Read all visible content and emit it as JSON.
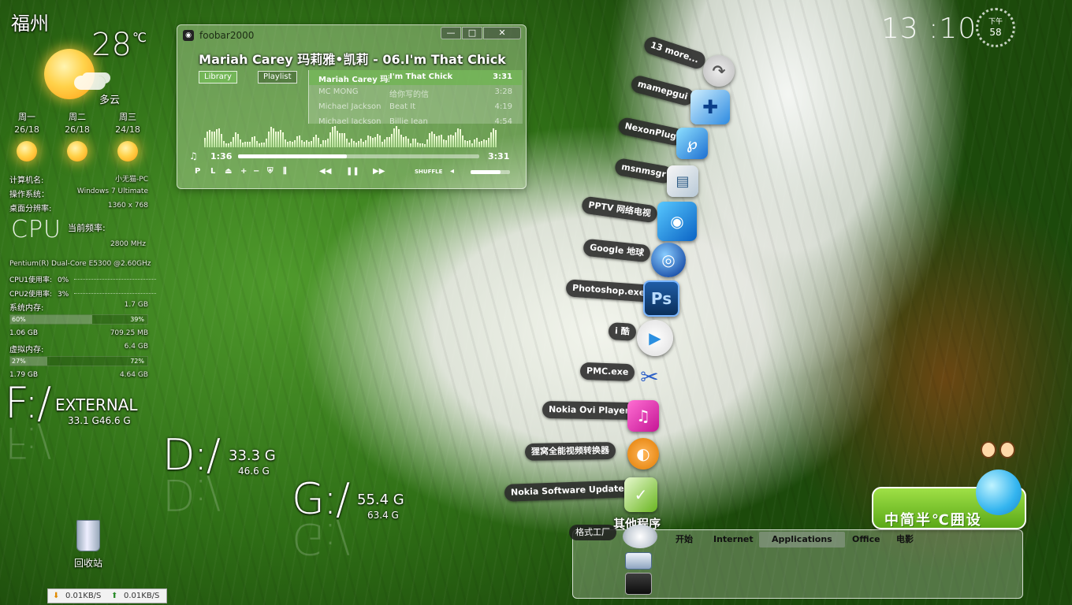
{
  "weather": {
    "city": "福州",
    "temp": "28",
    "unit": "℃",
    "condition": "多云",
    "forecast": [
      {
        "day": "周一",
        "temps": "26/18",
        "icon": "sun-icon"
      },
      {
        "day": "周二",
        "temps": "26/18",
        "icon": "sun-icon"
      },
      {
        "day": "周三",
        "temps": "24/18",
        "icon": "partly-cloudy-icon"
      }
    ]
  },
  "system": {
    "computer_label": "计算机名:",
    "computer_value": "小无猫-PC",
    "os_label": "操作系统：",
    "os_value": "Windows 7 Ultimate",
    "res_label": "桌面分辨率:",
    "res_value": "1360 x 768",
    "cpu_logo": "CPU",
    "freq_label": "当前频率:",
    "freq_value": "2800 MHz",
    "cpu_name": "Pentium(R) Dual-Core E5300 @2.60GHz",
    "cpu1_label": "CPU1使用率:",
    "cpu1_value": "0%",
    "cpu2_label": "CPU2使用率:",
    "cpu2_value": "3%",
    "mem_label": "系统内存:",
    "mem_total": "1.7 GB",
    "mem_used_pct": "60%",
    "mem_free_pct": "39%",
    "mem_used": "1.06 GB",
    "mem_free": "709.25 MB",
    "vmem_label": "虚拟内存:",
    "vmem_total": "6.4 GB",
    "vmem_used_pct": "27%",
    "vmem_free_pct": "72%",
    "vmem_used": "1.79 GB",
    "vmem_free": "4.64 GB",
    "mem_fill": 0.6,
    "vmem_fill": 0.27
  },
  "drives": [
    {
      "letter": "F:/",
      "name": "EXTERNAL",
      "sizes": "33.1 G46.6 G"
    },
    {
      "letter": "D:/",
      "name": "33.3 G",
      "sizes": "46.6 G"
    },
    {
      "letter": "G:/",
      "name": "55.4 G",
      "sizes": "63.4 G"
    }
  ],
  "desktop": {
    "recycle_bin": "回收站"
  },
  "netspeed": {
    "down": "0.01KB/S",
    "up": "0.01KB/S"
  },
  "foobar": {
    "window_title": "foobar2000",
    "track": "Mariah Carey 玛莉雅•凯莉 - 06.I'm That Chick",
    "tab_library": "Library",
    "tab_playlist": "Playlist",
    "playlist": [
      {
        "artist": "Mariah Carey 玛莉雅•凯莉",
        "song": "I'm That Chick",
        "duration": "3:31"
      },
      {
        "artist": "MC MONG",
        "song": "给你写的信",
        "duration": "3:28"
      },
      {
        "artist": "Michael Jackson",
        "song": "Beat It",
        "duration": "4:19"
      },
      {
        "artist": "Michael Jackson",
        "song": "Billie Jean",
        "duration": "4:54"
      }
    ],
    "time_current": "1:36",
    "time_total": "3:31",
    "progress": 0.45,
    "volume": 0.75,
    "shuffle": "SHUFFLE",
    "ctl_p": "P",
    "ctl_l": "L",
    "ctl_plus": "+",
    "ctl_minus": "−",
    "ctl_prev": "◀◀",
    "ctl_pause": "❚❚",
    "ctl_next": "▶▶",
    "win_min": "—",
    "win_max": "□",
    "win_close": "✕"
  },
  "clock": {
    "time": "13 :10",
    "period": "下午",
    "seconds": "58"
  },
  "stack": {
    "items": [
      {
        "label": "13 more...",
        "icon": "arrow-icon"
      },
      {
        "label": "mamepgui",
        "icon": "mame-icon"
      },
      {
        "label": "NexonPlug",
        "icon": "nexon-icon"
      },
      {
        "label": "msnmsgr",
        "icon": "msn-icon"
      },
      {
        "label": "PPTV 网络电视",
        "icon": "pptv-icon"
      },
      {
        "label": "Google 地球",
        "icon": "google-earth-icon"
      },
      {
        "label": "Photoshop.exe",
        "icon": "photoshop-icon"
      },
      {
        "label": "i 酷",
        "icon": "iku-icon"
      },
      {
        "label": "PMC.exe",
        "icon": "scissors-icon"
      },
      {
        "label": "Nokia Ovi Player",
        "icon": "music-note-icon"
      },
      {
        "label": "狸窝全能视频转换器",
        "icon": "video-converter-icon"
      },
      {
        "label": "Nokia Software Updater",
        "icon": "nokia-updater-icon"
      }
    ],
    "others": "其他程序",
    "ps_glyph": "Ps",
    "pptv_glyph": "◉",
    "iku_glyph": "▶",
    "pmc_glyph": "✂",
    "ovi_glyph": "♫",
    "conv_glyph": "◐",
    "nsu_glyph": "✓",
    "more_glyph": "↷",
    "mame_glyph": "✚",
    "nexon_glyph": "℘",
    "msn_glyph": "▤",
    "gearth_glyph": "◎"
  },
  "launcher": {
    "geshi": "格式工厂",
    "tabs": [
      "开始",
      "Internet",
      "Applications",
      "Office",
      "电影"
    ]
  },
  "kids_logo": {
    "text": "中简半℃囲设"
  }
}
